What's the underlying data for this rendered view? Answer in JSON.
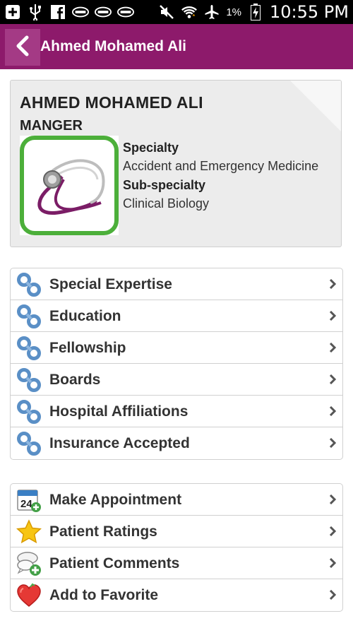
{
  "status_bar": {
    "battery_percent": "1%",
    "time": "10:55 PM"
  },
  "header": {
    "title": "Ahmed Mohamed Ali"
  },
  "profile": {
    "name": "AHMED MOHAMED ALI",
    "role": "MANGER",
    "specialty_label": "Specialty",
    "specialty_value": "Accident and Emergency Medicine",
    "subspecialty_label": "Sub-specialty",
    "subspecialty_value": "Clinical Biology"
  },
  "info_items": [
    {
      "label": "Special Expertise",
      "icon": "link-icon"
    },
    {
      "label": "Education",
      "icon": "link-icon"
    },
    {
      "label": "Fellowship",
      "icon": "link-icon"
    },
    {
      "label": "Boards",
      "icon": "link-icon"
    },
    {
      "label": "Hospital Affiliations",
      "icon": "link-icon"
    },
    {
      "label": "Insurance Accepted",
      "icon": "link-icon"
    }
  ],
  "action_items": [
    {
      "label": "Make Appointment",
      "icon": "calendar-add-icon"
    },
    {
      "label": "Patient Ratings",
      "icon": "star-icon"
    },
    {
      "label": "Patient Comments",
      "icon": "comment-add-icon"
    },
    {
      "label": "Add to Favorite",
      "icon": "heart-icon"
    }
  ],
  "colors": {
    "action_bar": "#8d1a6b",
    "back_button": "#a43a85",
    "card_background": "#ececec"
  }
}
